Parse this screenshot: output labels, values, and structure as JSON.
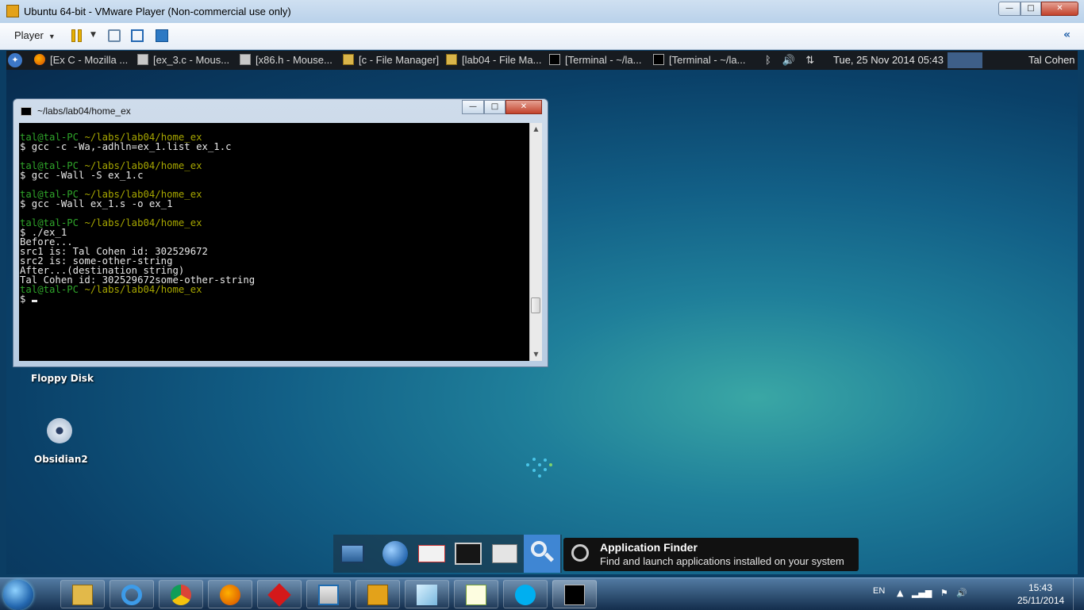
{
  "vm_window": {
    "title": "Ubuntu 64-bit - VMware Player (Non-commercial use only)",
    "minimize_glyph": "—",
    "maximize_glyph": "□",
    "close_glyph": "✕"
  },
  "vm_toolbar": {
    "player_label": "Player",
    "caret": "▼",
    "collapse_glyph": "«"
  },
  "xfce_panel": {
    "tasks": [
      {
        "label": "[Ex C - Mozilla ...",
        "icon": "firefox-icon"
      },
      {
        "label": "[ex_3.c - Mous...",
        "icon": "editor-icon"
      },
      {
        "label": "[x86.h - Mouse...",
        "icon": "editor-icon"
      },
      {
        "label": "[c - File Manager]",
        "icon": "folder-icon"
      },
      {
        "label": "[lab04 - File Ma...",
        "icon": "folder-icon"
      },
      {
        "label": "[Terminal - ~/la...",
        "icon": "terminal-icon"
      },
      {
        "label": "[Terminal - ~/la...",
        "icon": "terminal-icon"
      }
    ],
    "tray": {
      "bluetooth": "ᛒ",
      "volume": "🔊",
      "network": "⇅"
    },
    "clock": "Tue, 25 Nov 2014 05:43",
    "user": "Tal Cohen",
    "menu_glyph": "✦"
  },
  "desktop": {
    "icons": [
      {
        "label": "Floppy Disk"
      },
      {
        "label": "Obsidian2"
      }
    ]
  },
  "terminal": {
    "title": "~/labs/lab04/home_ex",
    "lines": [
      {
        "type": "prompt",
        "user": "tal@tal-PC",
        "path": "~/labs/lab04/home_ex"
      },
      {
        "type": "text",
        "text": "$ gcc -c -Wa,-adhln=ex_1.list ex_1.c"
      },
      {
        "type": "blank"
      },
      {
        "type": "prompt",
        "user": "tal@tal-PC",
        "path": "~/labs/lab04/home_ex"
      },
      {
        "type": "text",
        "text": "$ gcc -Wall -S ex_1.c"
      },
      {
        "type": "blank"
      },
      {
        "type": "prompt",
        "user": "tal@tal-PC",
        "path": "~/labs/lab04/home_ex"
      },
      {
        "type": "text",
        "text": "$ gcc -Wall ex_1.s -o ex_1"
      },
      {
        "type": "blank"
      },
      {
        "type": "prompt",
        "user": "tal@tal-PC",
        "path": "~/labs/lab04/home_ex"
      },
      {
        "type": "text",
        "text": "$ ./ex_1"
      },
      {
        "type": "text",
        "text": "Before..."
      },
      {
        "type": "text",
        "text": "src1 is: Tal Cohen id: 302529672"
      },
      {
        "type": "text",
        "text": "src2 is: some-other-string"
      },
      {
        "type": "text",
        "text": "After...(destination string)"
      },
      {
        "type": "text",
        "text": "Tal Cohen id: 302529672some-other-string"
      },
      {
        "type": "prompt",
        "user": "tal@tal-PC",
        "path": "~/labs/lab04/home_ex"
      },
      {
        "type": "input",
        "text": "$ "
      }
    ],
    "scroll_up": "▲",
    "scroll_down": "▼"
  },
  "dock": {
    "items": [
      "desktop-icon",
      "web-browser-icon",
      "mail-icon",
      "terminal-icon",
      "file-manager-icon",
      "app-finder-icon"
    ],
    "tooltip": {
      "title": "Application Finder",
      "description": "Find and launch applications installed on your system"
    }
  },
  "win_taskbar": {
    "pinned": [
      "explorer-icon",
      "internet-explorer-icon",
      "chrome-icon",
      "firefox-icon",
      "ruby-icon",
      "vmware-workstation-icon",
      "vmware-player-icon",
      "notes-icon",
      "notepad-plus-plus-icon",
      "skype-icon",
      "command-prompt-icon"
    ],
    "language": "EN",
    "tray_glyphs": {
      "show_hidden": "▲",
      "signal": "▂▄▆",
      "flag": "⚑",
      "volume": "🔊"
    },
    "time": "15:43",
    "date": "25/11/2014"
  }
}
